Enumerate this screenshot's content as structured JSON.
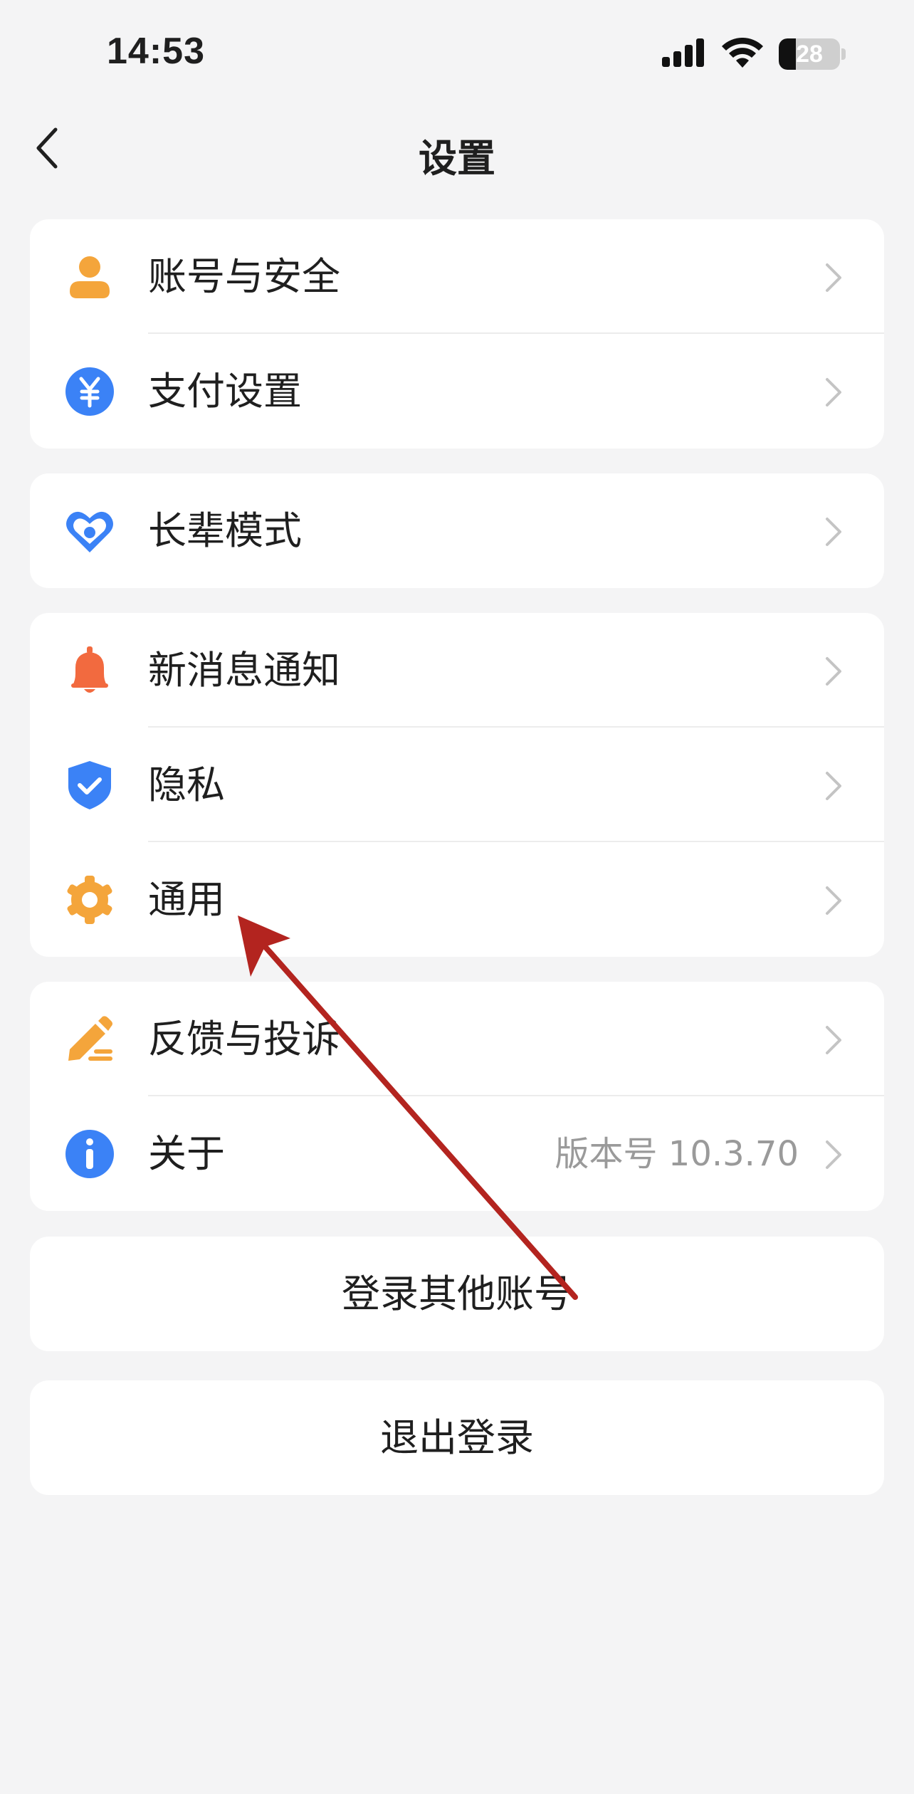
{
  "status_bar": {
    "time": "14:53",
    "battery_level": "28",
    "battery_fraction": 0.28,
    "icons": [
      "signal-icon",
      "wifi-icon",
      "battery-icon"
    ]
  },
  "header": {
    "title": "设置"
  },
  "groups": [
    {
      "items": [
        {
          "label": "账号与安全",
          "icon": "user-icon",
          "icon_color": "#f4a53b"
        },
        {
          "label": "支付设置",
          "icon": "yuan-icon",
          "icon_color": "#3b82f6"
        }
      ]
    },
    {
      "items": [
        {
          "label": "长辈模式",
          "icon": "heart-icon",
          "icon_color": "#3b82f6"
        }
      ]
    },
    {
      "items": [
        {
          "label": "新消息通知",
          "icon": "bell-icon",
          "icon_color": "#f26a3f"
        },
        {
          "label": "隐私",
          "icon": "shield-icon",
          "icon_color": "#3b82f6"
        },
        {
          "label": "通用",
          "icon": "gear-icon",
          "icon_color": "#f4a53b"
        }
      ]
    },
    {
      "items": [
        {
          "label": "反馈与投诉",
          "icon": "pencil-icon",
          "icon_color": "#f4a53b"
        },
        {
          "label": "关于",
          "icon": "info-icon",
          "icon_color": "#3b82f6",
          "value": "版本号 10.3.70"
        }
      ]
    }
  ],
  "actions": {
    "switch_account": "登录其他账号",
    "logout": "退出登录"
  },
  "annotation": {
    "type": "arrow",
    "color": "#b3241f",
    "points_to": "通用"
  }
}
